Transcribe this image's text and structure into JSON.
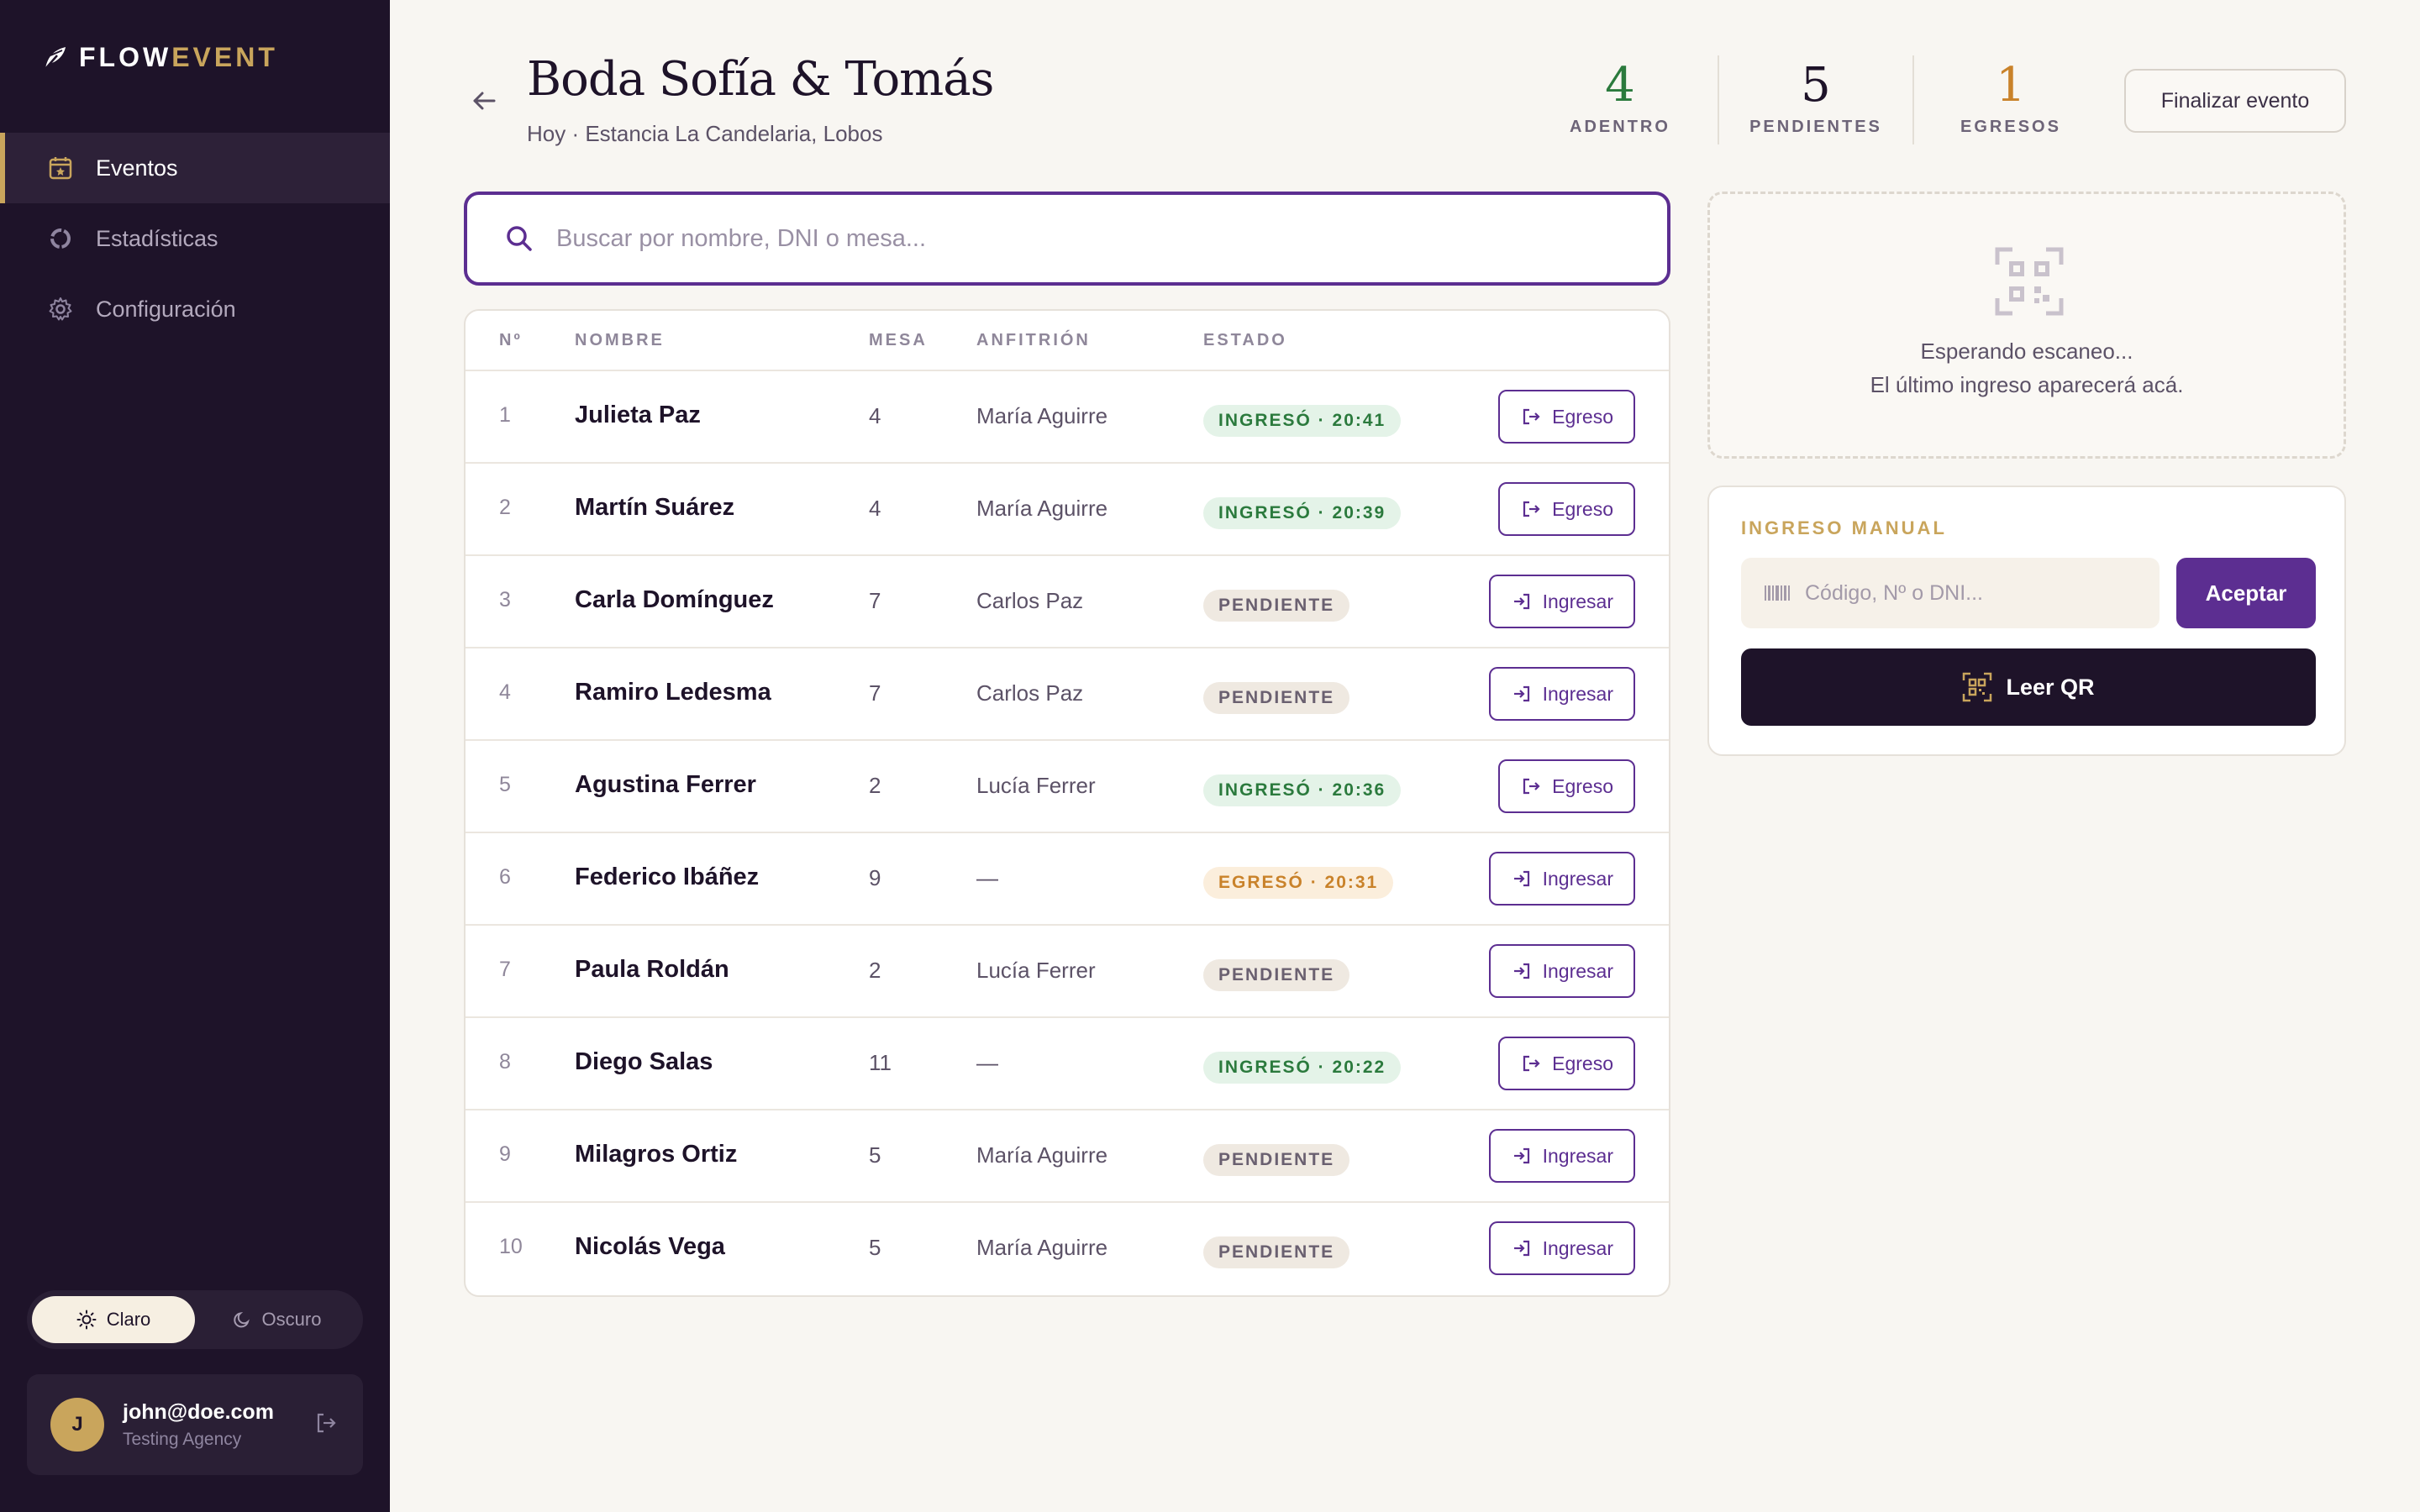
{
  "brand": {
    "name_part1": "FLOW",
    "name_part2": "EVENT"
  },
  "sidebar": {
    "items": [
      {
        "label": "Eventos",
        "icon": "calendar-star-icon",
        "active": true
      },
      {
        "label": "Estadísticas",
        "icon": "pie-chart-icon",
        "active": false
      },
      {
        "label": "Configuración",
        "icon": "gear-icon",
        "active": false
      }
    ],
    "theme": {
      "light": "Claro",
      "dark": "Oscuro",
      "selected": "Claro"
    },
    "user": {
      "initial": "J",
      "email": "john@doe.com",
      "agency": "Testing Agency"
    }
  },
  "header": {
    "title": "Boda Sofía & Tomás",
    "subtitle": "Hoy · Estancia La Candelaria, Lobos",
    "finalize_label": "Finalizar evento"
  },
  "stats": [
    {
      "value": "4",
      "label": "ADENTRO",
      "color": "#2b7a3d"
    },
    {
      "value": "5",
      "label": "PENDIENTES",
      "color": "#1e1329"
    },
    {
      "value": "1",
      "label": "EGRESOS",
      "color": "#c9822a"
    }
  ],
  "search": {
    "placeholder": "Buscar por nombre, DNI o mesa...",
    "value": ""
  },
  "table": {
    "columns": [
      "Nº",
      "NOMBRE",
      "MESA",
      "ANFITRIÓN",
      "ESTADO"
    ],
    "rows": [
      {
        "num": "1",
        "name": "Julieta Paz",
        "mesa": "4",
        "host": "María Aguirre",
        "status": "INGRESÓ · 20:41",
        "status_type": "in",
        "action": "Egreso"
      },
      {
        "num": "2",
        "name": "Martín Suárez",
        "mesa": "4",
        "host": "María Aguirre",
        "status": "INGRESÓ · 20:39",
        "status_type": "in",
        "action": "Egreso"
      },
      {
        "num": "3",
        "name": "Carla Domínguez",
        "mesa": "7",
        "host": "Carlos Paz",
        "status": "PENDIENTE",
        "status_type": "pend",
        "action": "Ingresar"
      },
      {
        "num": "4",
        "name": "Ramiro Ledesma",
        "mesa": "7",
        "host": "Carlos Paz",
        "status": "PENDIENTE",
        "status_type": "pend",
        "action": "Ingresar"
      },
      {
        "num": "5",
        "name": "Agustina Ferrer",
        "mesa": "2",
        "host": "Lucía Ferrer",
        "status": "INGRESÓ · 20:36",
        "status_type": "in",
        "action": "Egreso"
      },
      {
        "num": "6",
        "name": "Federico Ibáñez",
        "mesa": "9",
        "host": "—",
        "status": "EGRESÓ · 20:31",
        "status_type": "out",
        "action": "Ingresar"
      },
      {
        "num": "7",
        "name": "Paula Roldán",
        "mesa": "2",
        "host": "Lucía Ferrer",
        "status": "PENDIENTE",
        "status_type": "pend",
        "action": "Ingresar"
      },
      {
        "num": "8",
        "name": "Diego Salas",
        "mesa": "11",
        "host": "—",
        "status": "INGRESÓ · 20:22",
        "status_type": "in",
        "action": "Egreso"
      },
      {
        "num": "9",
        "name": "Milagros Ortiz",
        "mesa": "5",
        "host": "María Aguirre",
        "status": "PENDIENTE",
        "status_type": "pend",
        "action": "Ingresar"
      },
      {
        "num": "10",
        "name": "Nicolás Vega",
        "mesa": "5",
        "host": "María Aguirre",
        "status": "PENDIENTE",
        "status_type": "pend",
        "action": "Ingresar"
      }
    ]
  },
  "scan": {
    "line1": "Esperando escaneo...",
    "line2": "El último ingreso aparecerá acá."
  },
  "manual": {
    "title": "INGRESO MANUAL",
    "placeholder": "Código, Nº o DNI...",
    "value": "",
    "accept_label": "Aceptar",
    "qr_label": "Leer QR"
  }
}
